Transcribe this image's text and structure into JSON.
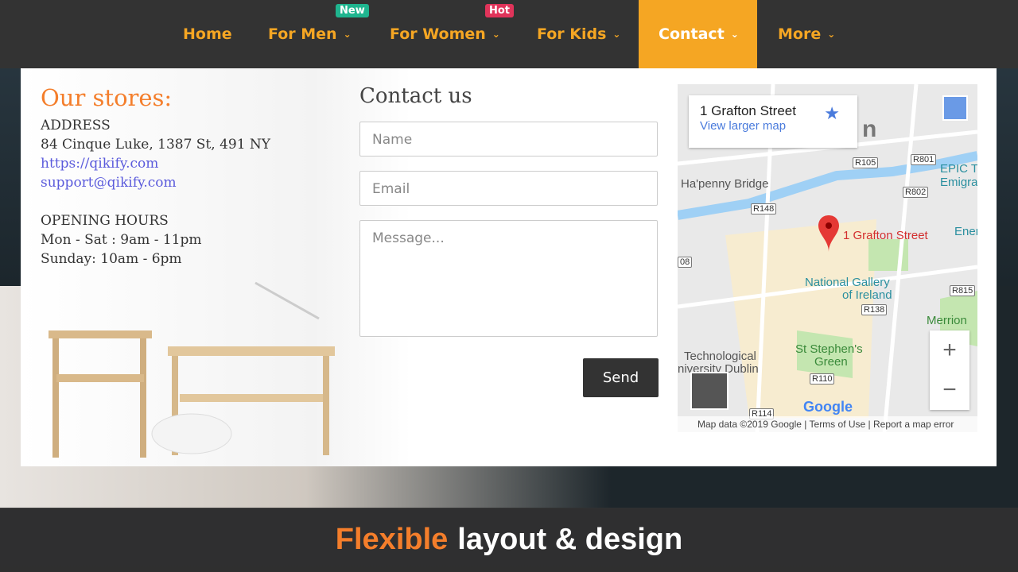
{
  "nav": {
    "items": [
      {
        "label": "Home"
      },
      {
        "label": "For Men",
        "badge": "New"
      },
      {
        "label": "For Women",
        "badge": "Hot"
      },
      {
        "label": "For Kids"
      },
      {
        "label": "Contact",
        "active": true
      },
      {
        "label": "More"
      }
    ],
    "chevron": "⌄",
    "colors": {
      "accent": "#f5a623",
      "new_badge": "#1fb58f",
      "hot_badge": "#e0345a"
    }
  },
  "stores": {
    "title": "Our stores:",
    "address_heading": "ADDRESS",
    "address": "84 Cinque Luke, 1387 St, 491 NY",
    "website": "https://qikify.com",
    "email": "support@qikify.com",
    "hours_heading": "OPENING HOURS",
    "hours_weekday": "Mon - Sat : 9am - 11pm",
    "hours_sunday": "Sunday: 10am - 6pm"
  },
  "contact": {
    "title": "Contact us",
    "name_placeholder": "Name",
    "email_placeholder": "Email",
    "message_placeholder": "Message...",
    "send_label": "Send"
  },
  "map": {
    "place": "1 Grafton Street",
    "view_larger": "View larger map",
    "pin_label": "1 Grafton Street",
    "labels": [
      "Ha'penny Bridge",
      "EPIC T",
      "Emigra",
      "National Gallery",
      "of Ireland",
      "Merrion",
      "St Stephen's",
      "Green",
      "Technological",
      "niversity Dublin",
      "Ener",
      "n"
    ],
    "roads": [
      "R105",
      "R801",
      "R802",
      "R148",
      "R815",
      "R138",
      "R110",
      "R114",
      "08"
    ],
    "google": "Google",
    "footer": {
      "data": "Map data ©2019 Google",
      "terms": "Terms of Use",
      "report": "Report a map error"
    },
    "zoom_in": "+",
    "zoom_out": "−"
  },
  "banner": {
    "highlight": "Flexible",
    "rest": "layout & design"
  }
}
